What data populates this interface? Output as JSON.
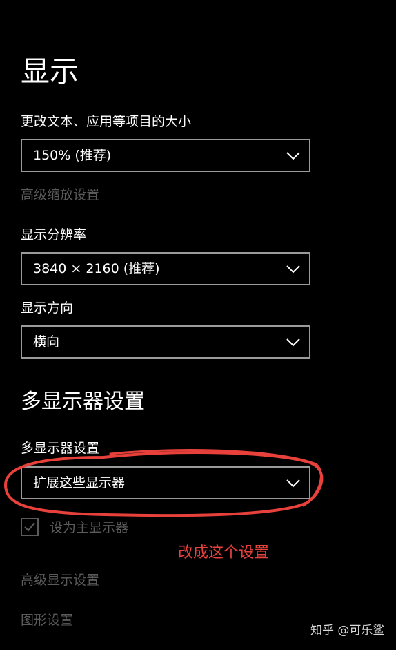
{
  "display": {
    "title": "显示",
    "scale": {
      "label": "更改文本、应用等项目的大小",
      "value": "150% (推荐)",
      "advanced_link": "高级缩放设置"
    },
    "resolution": {
      "label": "显示分辨率",
      "value": "3840 × 2160 (推荐)"
    },
    "orientation": {
      "label": "显示方向",
      "value": "横向"
    }
  },
  "multi_display": {
    "section_title": "多显示器设置",
    "label": "多显示器设置",
    "value": "扩展这些显示器",
    "main_display_checkbox": {
      "label": "设为主显示器",
      "checked": true,
      "enabled": false
    },
    "advanced_link": "高级显示设置",
    "graphics_link": "图形设置"
  },
  "annotation": {
    "text": "改成这个设置",
    "color": "#e8413c"
  },
  "watermark": "知乎 @可乐鲨",
  "icons": {
    "dropdown_chevron": "chevron-down-icon",
    "checkbox_check": "checkmark-icon"
  },
  "colors": {
    "background": "#000000",
    "text": "#ffffff",
    "disabled_text": "#5b5b5b",
    "dropdown_border": "#9a9a9a"
  }
}
